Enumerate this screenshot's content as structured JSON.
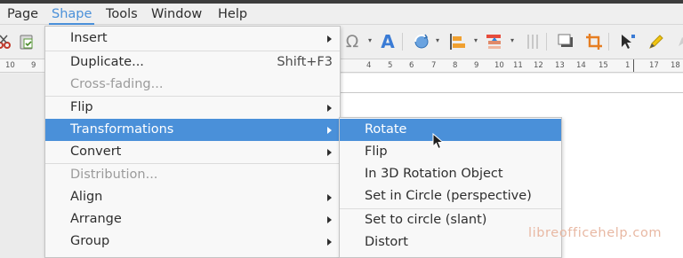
{
  "menubar": {
    "items": [
      {
        "label": "Page"
      },
      {
        "label": "Shape"
      },
      {
        "label": "Tools"
      },
      {
        "label": "Window"
      },
      {
        "label": "Help"
      }
    ]
  },
  "ruler": {
    "left_labels": [
      "10",
      "9"
    ],
    "right_labels": [
      "4",
      "5",
      "6",
      "7",
      "8",
      "9",
      "10",
      "11",
      "12",
      "13",
      "14",
      "15",
      "1",
      "17",
      "18"
    ]
  },
  "shape_menu": {
    "items": [
      {
        "label": "Insert",
        "submenu": true
      },
      {
        "label": "Duplicate...",
        "accelerator": "Shift+F3"
      },
      {
        "label": "Cross-fading...",
        "disabled": true
      },
      {
        "label": "Flip",
        "submenu": true
      },
      {
        "label": "Transformations",
        "submenu": true,
        "highlighted": true
      },
      {
        "label": "Convert",
        "submenu": true
      },
      {
        "label": "Distribution...",
        "disabled": true
      },
      {
        "label": "Align",
        "submenu": true
      },
      {
        "label": "Arrange",
        "submenu": true
      },
      {
        "label": "Group",
        "submenu": true
      }
    ]
  },
  "transformations_submenu": {
    "items": [
      {
        "label": "Rotate",
        "highlighted": true
      },
      {
        "label": "Flip"
      },
      {
        "label": "In 3D Rotation Object"
      },
      {
        "label": "Set in Circle (perspective)"
      },
      {
        "label": "Set to circle (slant)"
      },
      {
        "label": "Distort"
      }
    ]
  },
  "toolbar": {
    "icons": [
      "cut-icon",
      "paste-icon",
      "special-character-icon",
      "fontwork-icon",
      "transform-icon",
      "align-icon",
      "arrange-icon",
      "distribute-icon",
      "shadow-icon",
      "crop-icon",
      "points-icon",
      "glue-points-icon",
      "more-icon"
    ],
    "special_character_glyph": "Ω",
    "fontwork_glyph": "A"
  },
  "watermark": "libreofficehelp.com",
  "colors": {
    "accent": "#4a90d9",
    "menu_background": "#f8f8f8",
    "disabled_text": "#9b9b9b",
    "watermark": "#e8b8a3"
  }
}
